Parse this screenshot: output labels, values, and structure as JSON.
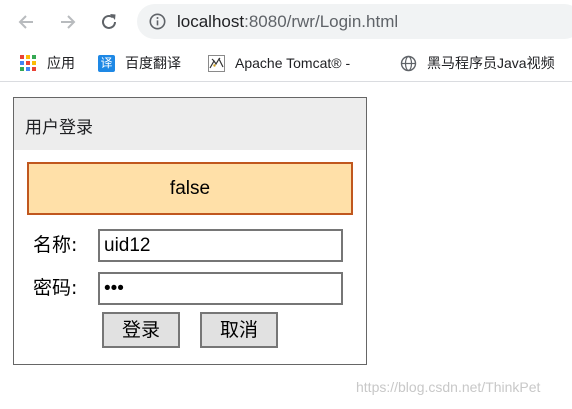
{
  "browser": {
    "url_host": "localhost",
    "url_rest": ":8080/rwr/Login.html",
    "icons": {
      "back": "arrow-left",
      "forward": "arrow-right",
      "reload": "reload",
      "info": "info-circle"
    }
  },
  "bookmarks": [
    {
      "label": "应用",
      "icon": "apps-grid"
    },
    {
      "label": "百度翻译",
      "icon": "fanyi",
      "icon_text": "译"
    },
    {
      "label": "Apache Tomcat® -",
      "icon": "tomcat"
    },
    {
      "label": "黑马程序员Java视频",
      "icon": "globe"
    }
  ],
  "login": {
    "title": "用户登录",
    "message": "false",
    "name_label": "名称:",
    "name_value": "uid12",
    "password_label": "密码:",
    "password_value": "•••",
    "login_button": "登录",
    "cancel_button": "取消"
  },
  "watermark": "https://blog.csdn.net/ThinkPet",
  "colors": {
    "message_bg": "#ffe0a8",
    "message_border": "#c0571e",
    "header_bg": "#ededed",
    "button_bg": "#e1e1e1",
    "apps_grid": [
      "#ea4335",
      "#fbbc05",
      "#34a853",
      "#4285f4",
      "#ea4335",
      "#fbbc05",
      "#34a853",
      "#4285f4",
      "#ea4335"
    ]
  }
}
